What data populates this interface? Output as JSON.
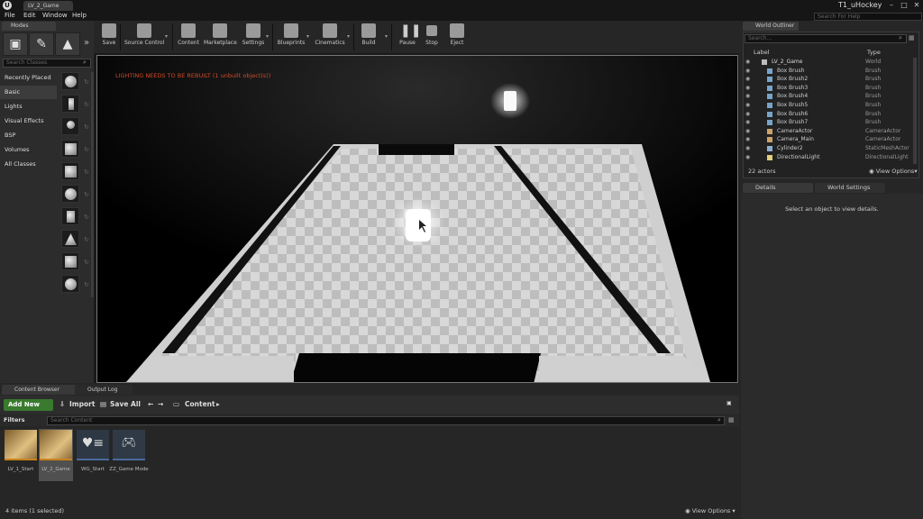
{
  "titlebar": {
    "doc_tab": "LV_2_Game",
    "project": "T1_uHockey",
    "minimize": "–",
    "maximize": "□",
    "close": "✕"
  },
  "menu": {
    "items": [
      "File",
      "Edit",
      "Window",
      "Help"
    ],
    "search_placeholder": "Search For Help"
  },
  "modes": {
    "tab_label": "Modes",
    "search_placeholder": "Search Classes",
    "categories": [
      "Recently Placed",
      "Basic",
      "Lights",
      "Visual Effects",
      "BSP",
      "Volumes",
      "All Classes"
    ],
    "active_category": "Basic"
  },
  "toolbar": {
    "buttons": [
      "Save",
      "Source Control",
      "Content",
      "Marketplace",
      "Settings",
      "Blueprints",
      "Cinematics",
      "Build",
      "Pause",
      "Stop",
      "Eject"
    ]
  },
  "viewport": {
    "lighting_message": "LIGHTING NEEDS TO BE REBUILT (1 unbuilt object(s))"
  },
  "bottom_tabs": {
    "content_browser": "Content Browser",
    "output_log": "Output Log"
  },
  "content_browser": {
    "add_new": "Add New",
    "import": "Import",
    "save_all": "Save All",
    "path": "Content",
    "filters": "Filters",
    "search_placeholder": "Search Content",
    "assets": [
      "LV_1_Start",
      "LV_2_Game",
      "WG_Start",
      "ZZ_Game Mode"
    ],
    "items_count": "4 items (1 selected)",
    "view_options": "View Options"
  },
  "world_outliner": {
    "tab_label": "World Outliner",
    "search_placeholder": "Search...",
    "col_label": "Label",
    "col_type": "Type",
    "rows": [
      {
        "label": "LV_2_Game",
        "type": "World"
      },
      {
        "label": "Box Brush",
        "type": "Brush"
      },
      {
        "label": "Box Brush2",
        "type": "Brush"
      },
      {
        "label": "Box Brush3",
        "type": "Brush"
      },
      {
        "label": "Box Brush4",
        "type": "Brush"
      },
      {
        "label": "Box Brush5",
        "type": "Brush"
      },
      {
        "label": "Box Brush6",
        "type": "Brush"
      },
      {
        "label": "Box Brush7",
        "type": "Brush"
      },
      {
        "label": "CameraActor",
        "type": "CameraActor"
      },
      {
        "label": "Camera_Main",
        "type": "CameraActor"
      },
      {
        "label": "Cylinder2",
        "type": "StaticMeshActor"
      },
      {
        "label": "DirectionalLight",
        "type": "DirectionalLight"
      }
    ],
    "actors_count": "22 actors",
    "view_options": "View Options"
  },
  "details": {
    "tab_label": "Details",
    "world_settings_tab": "World Settings",
    "empty_message": "Select an object to view details."
  },
  "colors": {
    "accent_green": "#397a2e",
    "warning_red": "#d04a2a",
    "asset_underline": "#c9811a"
  }
}
